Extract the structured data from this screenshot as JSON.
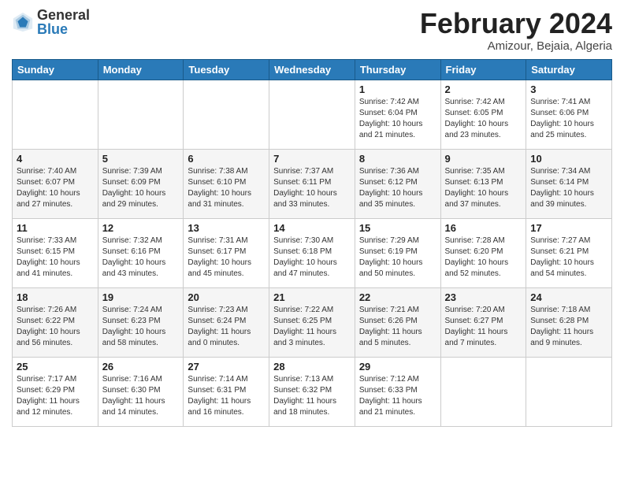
{
  "logo": {
    "general": "General",
    "blue": "Blue"
  },
  "title": "February 2024",
  "subtitle": "Amizour, Bejaia, Algeria",
  "days_of_week": [
    "Sunday",
    "Monday",
    "Tuesday",
    "Wednesday",
    "Thursday",
    "Friday",
    "Saturday"
  ],
  "weeks": [
    [
      {
        "day": "",
        "info": ""
      },
      {
        "day": "",
        "info": ""
      },
      {
        "day": "",
        "info": ""
      },
      {
        "day": "",
        "info": ""
      },
      {
        "day": "1",
        "info": "Sunrise: 7:42 AM\nSunset: 6:04 PM\nDaylight: 10 hours and 21 minutes."
      },
      {
        "day": "2",
        "info": "Sunrise: 7:42 AM\nSunset: 6:05 PM\nDaylight: 10 hours and 23 minutes."
      },
      {
        "day": "3",
        "info": "Sunrise: 7:41 AM\nSunset: 6:06 PM\nDaylight: 10 hours and 25 minutes."
      }
    ],
    [
      {
        "day": "4",
        "info": "Sunrise: 7:40 AM\nSunset: 6:07 PM\nDaylight: 10 hours and 27 minutes."
      },
      {
        "day": "5",
        "info": "Sunrise: 7:39 AM\nSunset: 6:09 PM\nDaylight: 10 hours and 29 minutes."
      },
      {
        "day": "6",
        "info": "Sunrise: 7:38 AM\nSunset: 6:10 PM\nDaylight: 10 hours and 31 minutes."
      },
      {
        "day": "7",
        "info": "Sunrise: 7:37 AM\nSunset: 6:11 PM\nDaylight: 10 hours and 33 minutes."
      },
      {
        "day": "8",
        "info": "Sunrise: 7:36 AM\nSunset: 6:12 PM\nDaylight: 10 hours and 35 minutes."
      },
      {
        "day": "9",
        "info": "Sunrise: 7:35 AM\nSunset: 6:13 PM\nDaylight: 10 hours and 37 minutes."
      },
      {
        "day": "10",
        "info": "Sunrise: 7:34 AM\nSunset: 6:14 PM\nDaylight: 10 hours and 39 minutes."
      }
    ],
    [
      {
        "day": "11",
        "info": "Sunrise: 7:33 AM\nSunset: 6:15 PM\nDaylight: 10 hours and 41 minutes."
      },
      {
        "day": "12",
        "info": "Sunrise: 7:32 AM\nSunset: 6:16 PM\nDaylight: 10 hours and 43 minutes."
      },
      {
        "day": "13",
        "info": "Sunrise: 7:31 AM\nSunset: 6:17 PM\nDaylight: 10 hours and 45 minutes."
      },
      {
        "day": "14",
        "info": "Sunrise: 7:30 AM\nSunset: 6:18 PM\nDaylight: 10 hours and 47 minutes."
      },
      {
        "day": "15",
        "info": "Sunrise: 7:29 AM\nSunset: 6:19 PM\nDaylight: 10 hours and 50 minutes."
      },
      {
        "day": "16",
        "info": "Sunrise: 7:28 AM\nSunset: 6:20 PM\nDaylight: 10 hours and 52 minutes."
      },
      {
        "day": "17",
        "info": "Sunrise: 7:27 AM\nSunset: 6:21 PM\nDaylight: 10 hours and 54 minutes."
      }
    ],
    [
      {
        "day": "18",
        "info": "Sunrise: 7:26 AM\nSunset: 6:22 PM\nDaylight: 10 hours and 56 minutes."
      },
      {
        "day": "19",
        "info": "Sunrise: 7:24 AM\nSunset: 6:23 PM\nDaylight: 10 hours and 58 minutes."
      },
      {
        "day": "20",
        "info": "Sunrise: 7:23 AM\nSunset: 6:24 PM\nDaylight: 11 hours and 0 minutes."
      },
      {
        "day": "21",
        "info": "Sunrise: 7:22 AM\nSunset: 6:25 PM\nDaylight: 11 hours and 3 minutes."
      },
      {
        "day": "22",
        "info": "Sunrise: 7:21 AM\nSunset: 6:26 PM\nDaylight: 11 hours and 5 minutes."
      },
      {
        "day": "23",
        "info": "Sunrise: 7:20 AM\nSunset: 6:27 PM\nDaylight: 11 hours and 7 minutes."
      },
      {
        "day": "24",
        "info": "Sunrise: 7:18 AM\nSunset: 6:28 PM\nDaylight: 11 hours and 9 minutes."
      }
    ],
    [
      {
        "day": "25",
        "info": "Sunrise: 7:17 AM\nSunset: 6:29 PM\nDaylight: 11 hours and 12 minutes."
      },
      {
        "day": "26",
        "info": "Sunrise: 7:16 AM\nSunset: 6:30 PM\nDaylight: 11 hours and 14 minutes."
      },
      {
        "day": "27",
        "info": "Sunrise: 7:14 AM\nSunset: 6:31 PM\nDaylight: 11 hours and 16 minutes."
      },
      {
        "day": "28",
        "info": "Sunrise: 7:13 AM\nSunset: 6:32 PM\nDaylight: 11 hours and 18 minutes."
      },
      {
        "day": "29",
        "info": "Sunrise: 7:12 AM\nSunset: 6:33 PM\nDaylight: 11 hours and 21 minutes."
      },
      {
        "day": "",
        "info": ""
      },
      {
        "day": "",
        "info": ""
      }
    ]
  ]
}
